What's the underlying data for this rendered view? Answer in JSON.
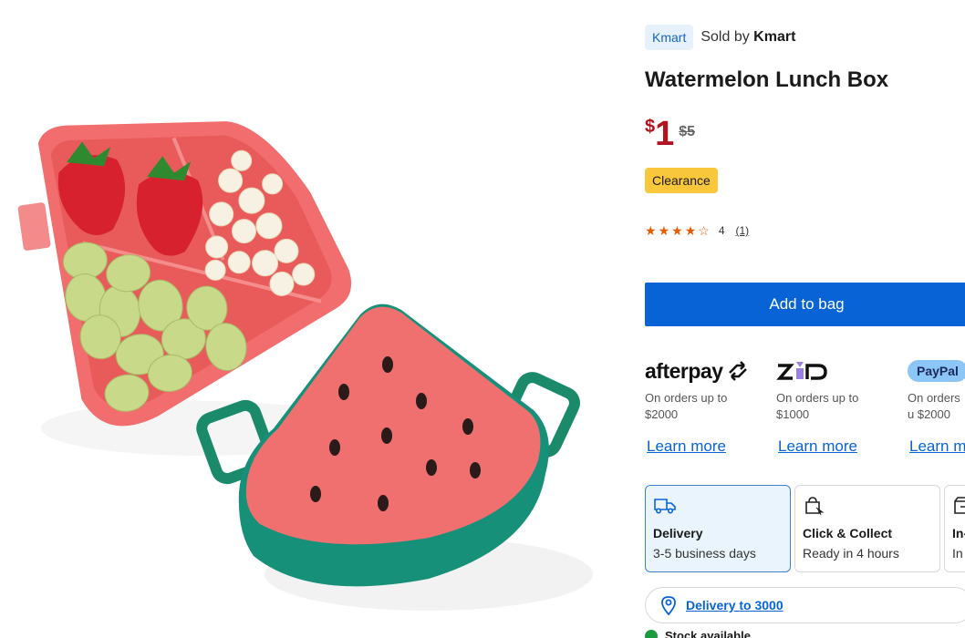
{
  "product": {
    "brand_badge": "Kmart",
    "sold_by_prefix": "Sold by",
    "sold_by_name": "Kmart",
    "title": "Watermelon Lunch Box",
    "price": {
      "currency": "$",
      "value": "1",
      "was": "$5"
    },
    "badge": "Clearance",
    "rating": {
      "stars": 3.5,
      "value": "4",
      "count": "(1)",
      "star_color": "#e65c00"
    },
    "image_alt": "watermelon-lunch-box-with-fruit"
  },
  "actions": {
    "add_to_bag_label": "Add to bag",
    "accent": "#0864d6"
  },
  "payments": [
    {
      "logo": "afterpay",
      "logo_text": "afterpay",
      "note": "On orders up to $2000",
      "learn_more": "Learn more"
    },
    {
      "logo": "zip",
      "logo_text": "zip",
      "note": "On orders up to $1000",
      "learn_more": "Learn more"
    },
    {
      "logo": "paypal",
      "logo_text": "PayPal",
      "note": "On orders u $2000",
      "learn_more": "Learn m"
    }
  ],
  "fulfilment": [
    {
      "icon": "truck-icon",
      "title": "Delivery",
      "subtitle": "3-5 business days",
      "selected": true
    },
    {
      "icon": "bag-icon",
      "title": "Click & Collect",
      "subtitle": "Ready in 4 hours",
      "selected": false
    },
    {
      "icon": "store-icon",
      "title": "In-",
      "subtitle": "In",
      "selected": false
    }
  ],
  "location": {
    "icon": "location-pin-icon",
    "label": "Delivery to 3000"
  },
  "stock": {
    "text": "Stock available"
  }
}
